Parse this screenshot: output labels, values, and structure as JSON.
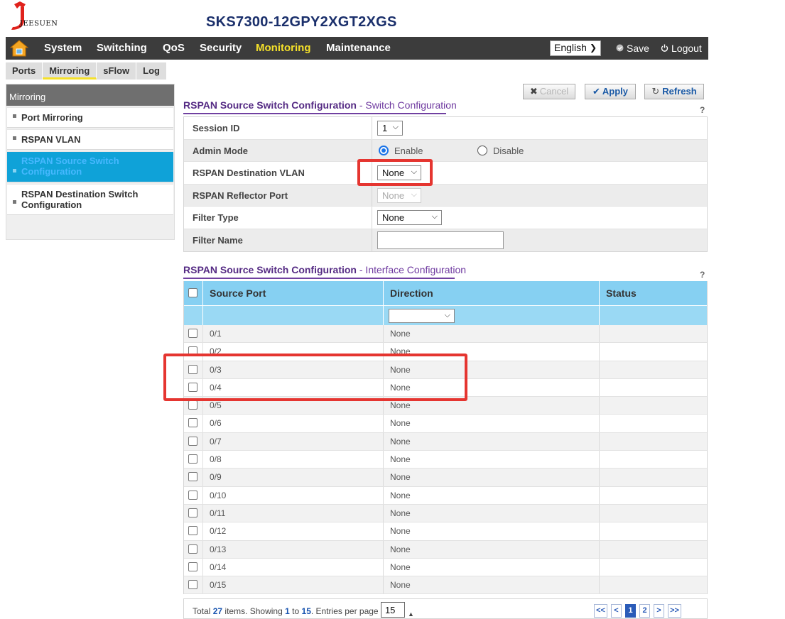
{
  "header": {
    "logo_text": "JEESUEN",
    "model": "SKS7300-12GPY2XGT2XGS"
  },
  "nav": {
    "items": [
      {
        "label": "System",
        "active": false
      },
      {
        "label": "Switching",
        "active": false
      },
      {
        "label": "QoS",
        "active": false
      },
      {
        "label": "Security",
        "active": false
      },
      {
        "label": "Monitoring",
        "active": true
      },
      {
        "label": "Maintenance",
        "active": false
      }
    ],
    "language": "English",
    "save_label": "Save",
    "logout_label": "Logout"
  },
  "subtabs": [
    {
      "label": "Ports",
      "active": false
    },
    {
      "label": "Mirroring",
      "active": true
    },
    {
      "label": "sFlow",
      "active": false
    },
    {
      "label": "Log",
      "active": false
    }
  ],
  "sidebar": {
    "title": "Mirroring",
    "items": [
      {
        "label": "Port Mirroring",
        "active": false
      },
      {
        "label": "RSPAN VLAN",
        "active": false
      },
      {
        "label": "RSPAN Source Switch Configuration",
        "active": true
      },
      {
        "label": "RSPAN Destination Switch Configuration",
        "active": false
      }
    ]
  },
  "buttons": {
    "cancel": "Cancel",
    "apply": "Apply",
    "refresh": "Refresh",
    "help": "?"
  },
  "switch_config": {
    "title": "RSPAN Source Switch Configuration",
    "subtitle": "- Switch Configuration",
    "rows": {
      "session_id": {
        "label": "Session ID",
        "value": "1"
      },
      "admin_mode": {
        "label": "Admin Mode",
        "enable": "Enable",
        "disable": "Disable",
        "selected": "Enable"
      },
      "dest_vlan": {
        "label": "RSPAN Destination VLAN",
        "value": "None"
      },
      "reflector_port": {
        "label": "RSPAN Reflector Port",
        "value": "None"
      },
      "filter_type": {
        "label": "Filter Type",
        "value": "None"
      },
      "filter_name": {
        "label": "Filter Name",
        "value": ""
      }
    }
  },
  "interface_config": {
    "title": "RSPAN Source Switch Configuration",
    "subtitle": "- Interface Configuration",
    "columns": [
      "Source Port",
      "Direction",
      "Status"
    ],
    "rows": [
      {
        "port": "0/1",
        "direction": "None",
        "status": ""
      },
      {
        "port": "0/2",
        "direction": "None",
        "status": ""
      },
      {
        "port": "0/3",
        "direction": "None",
        "status": ""
      },
      {
        "port": "0/4",
        "direction": "None",
        "status": ""
      },
      {
        "port": "0/5",
        "direction": "None",
        "status": ""
      },
      {
        "port": "0/6",
        "direction": "None",
        "status": ""
      },
      {
        "port": "0/7",
        "direction": "None",
        "status": ""
      },
      {
        "port": "0/8",
        "direction": "None",
        "status": ""
      },
      {
        "port": "0/9",
        "direction": "None",
        "status": ""
      },
      {
        "port": "0/10",
        "direction": "None",
        "status": ""
      },
      {
        "port": "0/11",
        "direction": "None",
        "status": ""
      },
      {
        "port": "0/12",
        "direction": "None",
        "status": ""
      },
      {
        "port": "0/13",
        "direction": "None",
        "status": ""
      },
      {
        "port": "0/14",
        "direction": "None",
        "status": ""
      },
      {
        "port": "0/15",
        "direction": "None",
        "status": ""
      }
    ]
  },
  "footer": {
    "total_prefix": "Total",
    "total": "27",
    "items_showing": "items. Showing",
    "from": "1",
    "to_word": "to",
    "to": "15",
    "entries_label": ". Entries per page",
    "per_page": "15",
    "pager": [
      "<<",
      "<",
      "1",
      "2",
      ">",
      ">>"
    ],
    "current_page": "1"
  },
  "colors": {
    "nav_bg": "#3c3c3c",
    "nav_active": "#f5e12a",
    "sidebar_active": "#0fa2d8",
    "table_header": "#86d0f2",
    "title_purple": "#552b84",
    "highlight_red": "#e53530"
  }
}
